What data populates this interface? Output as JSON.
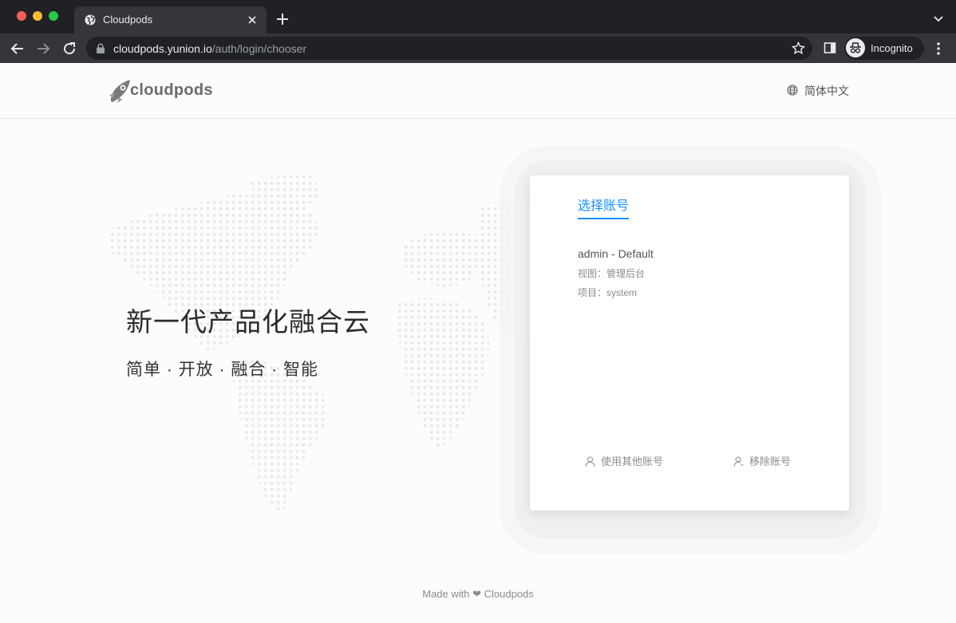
{
  "browser": {
    "tab_title": "Cloudpods",
    "url_host": "cloudpods.yunion.io",
    "url_path": "/auth/login/chooser",
    "incognito_label": "Incognito",
    "icons": [
      "back-icon",
      "forward-icon",
      "reload-icon",
      "lock-icon",
      "star-icon",
      "side-panel-icon",
      "incognito-icon",
      "more-icon",
      "new-tab-icon",
      "tab-search-icon",
      "globe-icon"
    ]
  },
  "header": {
    "logo_text": "cloudpods",
    "language": "简体中文"
  },
  "hero": {
    "slogan": "新一代产品化融合云",
    "subslogan": "简单 · 开放 · 融合 · 智能"
  },
  "chooser": {
    "tab_label": "选择账号",
    "account": {
      "name": "admin - Default",
      "view": "视图：管理后台",
      "project": "项目：system"
    },
    "use_other_label": "使用其他账号",
    "remove_label": "移除账号"
  },
  "footer": {
    "made_with": "Made with",
    "heart": "❤",
    "brand": "Cloudpods"
  },
  "colors": {
    "accent": "#1890ff",
    "chrome_dark": "#202124",
    "chrome_tab": "#35363a"
  }
}
